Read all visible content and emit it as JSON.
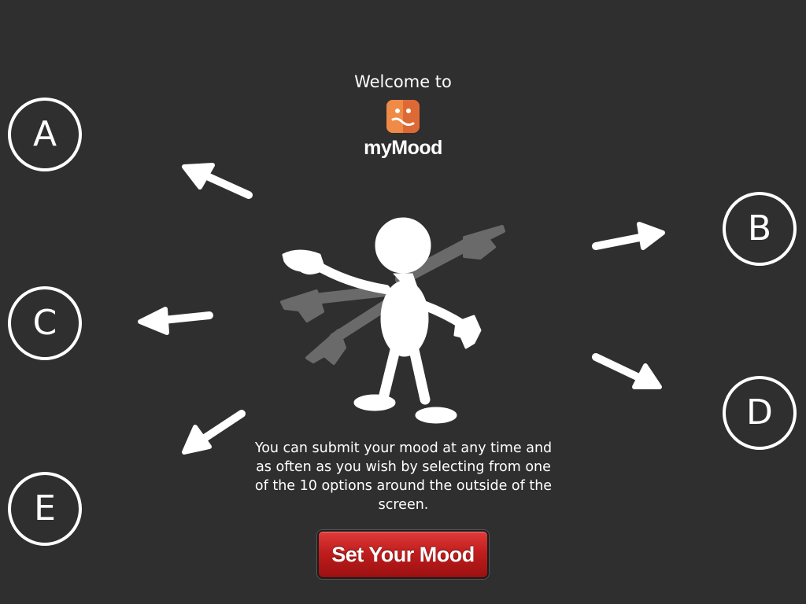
{
  "welcome": {
    "greeting": "Welcome to",
    "app_name": "myMood"
  },
  "options": {
    "a": "A",
    "b": "B",
    "c": "C",
    "d": "D",
    "e": "E"
  },
  "instructions": "You can submit your mood at any time and as often as you wish by selecting from one of the 10 options around the outside of the screen.",
  "button": {
    "label": "Set Your Mood"
  },
  "colors": {
    "background": "#2f2f2f",
    "foreground": "#ffffff",
    "button_red": "#c01e1e",
    "icon_orange": "#e2703a"
  },
  "icons": {
    "app_icon": "mood-face-icon",
    "figure": "stick-figure-pointing-icon",
    "arrows": [
      "arrow-up-left-icon",
      "arrow-left-icon",
      "arrow-down-left-icon",
      "arrow-right-icon",
      "arrow-down-right-icon"
    ]
  }
}
